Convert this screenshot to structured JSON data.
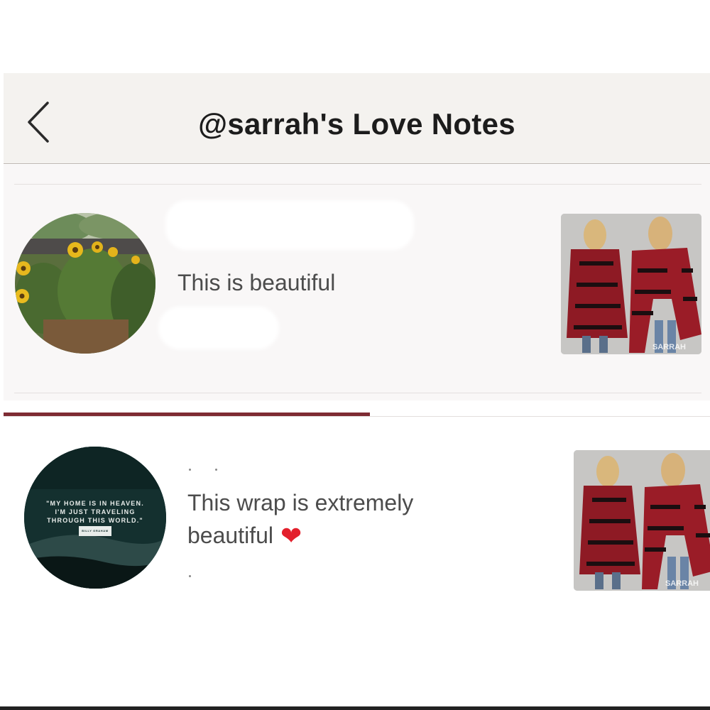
{
  "header": {
    "title": "@sarrah's Love Notes",
    "back_icon": "chevron-left-icon"
  },
  "notes": [
    {
      "text": "This is beautiful",
      "avatar": "sunflower-photo-avatar",
      "product_watermark": "SARRAH"
    },
    {
      "text": "This wrap is extremely beautiful",
      "emoji": "❤",
      "avatar": {
        "quote_line_1": "\"MY HOME IS IN HEAVEN.",
        "quote_line_2": "I'M JUST TRAVELING",
        "quote_line_3": "THROUGH THIS WORLD.\"",
        "attribution": "BILLY GRAHAM"
      },
      "product_watermark": "SARRAH"
    }
  ],
  "tabs": {
    "active_indicator_color": "#7e2b33"
  },
  "colors": {
    "header_bg": "#f4f2ef",
    "text": "#4c4c4c",
    "title": "#1c1c1c",
    "accent": "#7e2b33"
  }
}
